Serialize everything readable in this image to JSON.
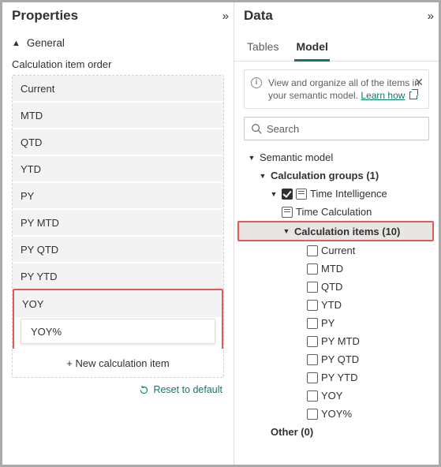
{
  "left": {
    "title": "Properties",
    "general_label": "General",
    "field_label": "Calculation item order",
    "items": [
      "Current",
      "MTD",
      "QTD",
      "YTD",
      "PY",
      "PY MTD",
      "PY QTD",
      "PY YTD",
      "YOY"
    ],
    "editing_value": "YOY%",
    "new_item_label": "+ New calculation item",
    "reset_label": "Reset to default"
  },
  "right": {
    "title": "Data",
    "tabs": {
      "tables": "Tables",
      "model": "Model"
    },
    "banner": {
      "text": "View and organize all of the items in your semantic model. ",
      "link": "Learn how"
    },
    "search_placeholder": "Search",
    "tree": {
      "root": "Semantic model",
      "calc_groups": "Calculation groups (1)",
      "time_intel": "Time Intelligence",
      "time_calc": "Time Calculation",
      "calc_items": "Calculation items (10)",
      "items": [
        "Current",
        "MTD",
        "QTD",
        "YTD",
        "PY",
        "PY MTD",
        "PY QTD",
        "PY YTD",
        "YOY",
        "YOY%"
      ],
      "other": "Other (0)"
    }
  }
}
